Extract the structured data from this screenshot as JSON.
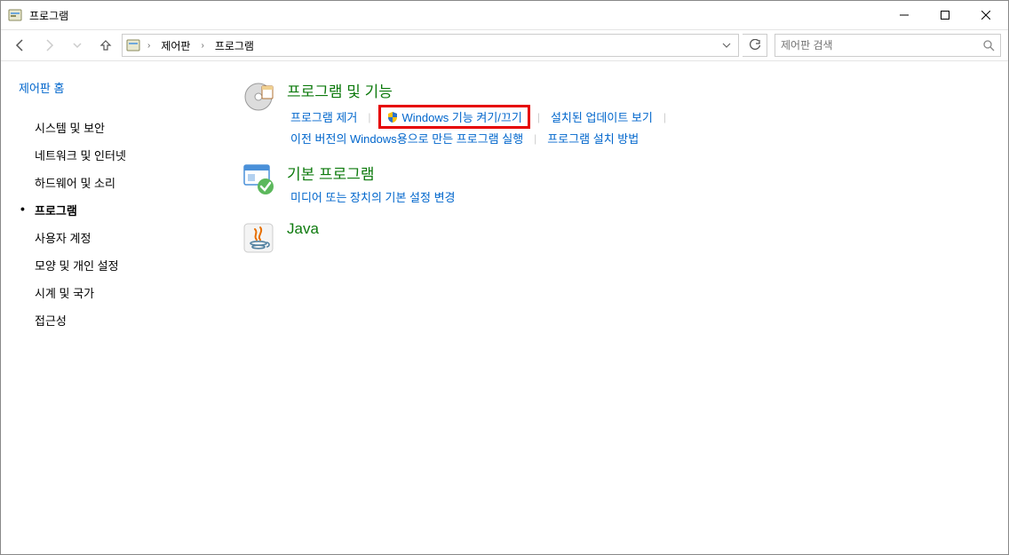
{
  "window": {
    "title": "프로그램"
  },
  "breadcrumb": {
    "root": "제어판",
    "current": "프로그램"
  },
  "search": {
    "placeholder": "제어판 검색"
  },
  "sidebar": {
    "home": "제어판 홈",
    "items": [
      {
        "label": "시스템 및 보안",
        "active": false
      },
      {
        "label": "네트워크 및 인터넷",
        "active": false
      },
      {
        "label": "하드웨어 및 소리",
        "active": false
      },
      {
        "label": "프로그램",
        "active": true
      },
      {
        "label": "사용자 계정",
        "active": false
      },
      {
        "label": "모양 및 개인 설정",
        "active": false
      },
      {
        "label": "시계 및 국가",
        "active": false
      },
      {
        "label": "접근성",
        "active": false
      }
    ]
  },
  "sections": {
    "programs": {
      "title": "프로그램 및 기능",
      "links": {
        "uninstall": "프로그램 제거",
        "windows_features": "Windows 기능 켜기/끄기",
        "view_updates": "설치된 업데이트 보기",
        "run_legacy": "이전 버전의 Windows용으로 만든 프로그램 실행",
        "how_install": "프로그램 설치 방법"
      }
    },
    "default_programs": {
      "title": "기본 프로그램",
      "links": {
        "media": "미디어 또는 장치의 기본 설정 변경"
      }
    },
    "java": {
      "title": "Java"
    }
  }
}
